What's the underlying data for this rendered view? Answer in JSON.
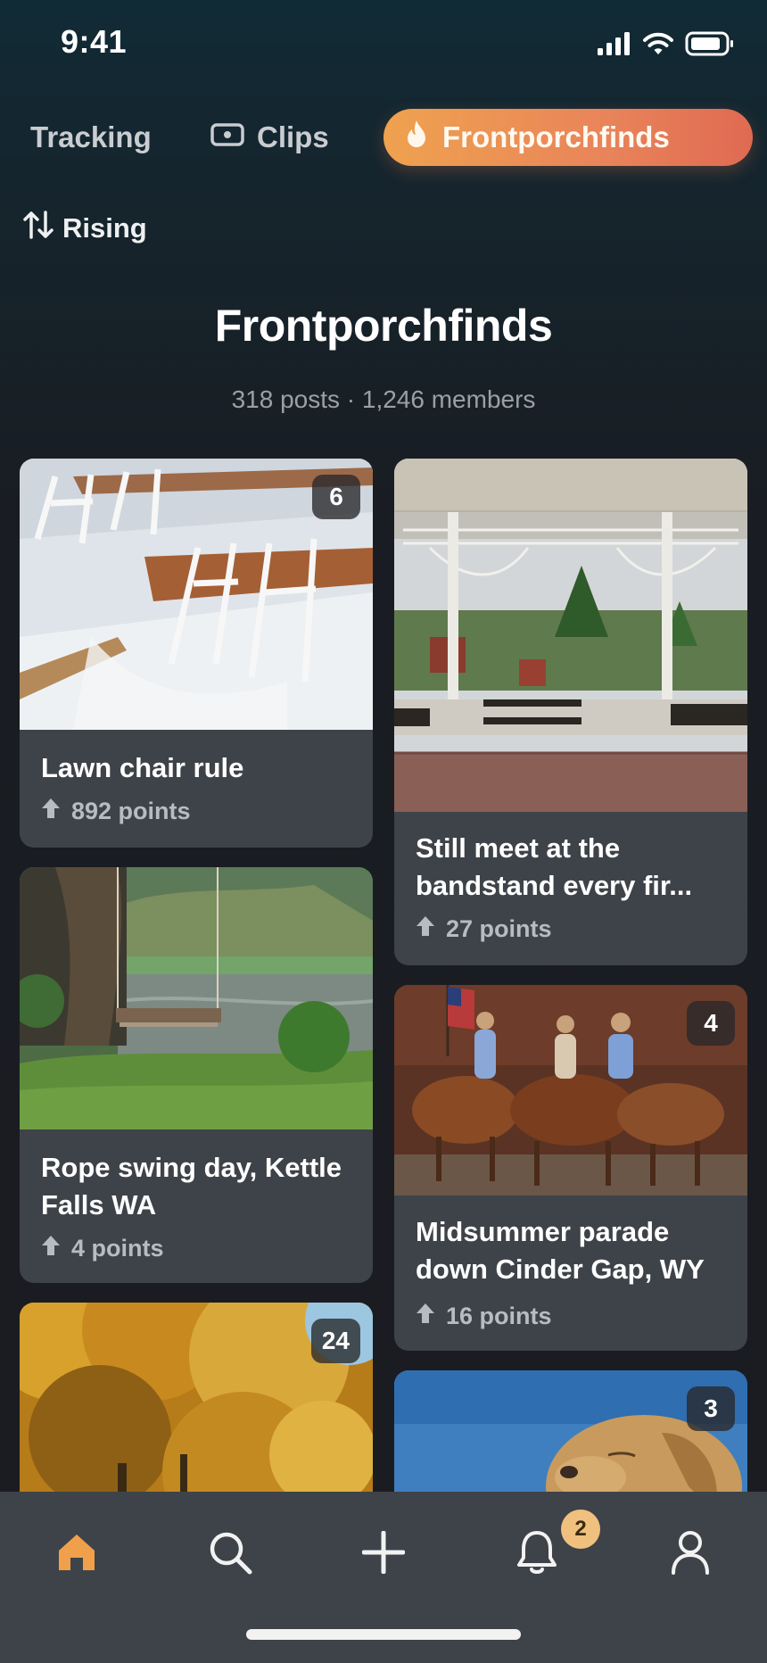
{
  "status_bar": {
    "time": "9:41"
  },
  "tabs": [
    {
      "label": "Tracking"
    },
    {
      "label": "Clips",
      "icon": "video-icon"
    },
    {
      "label": "Frontporchfinds",
      "icon": "flame-icon",
      "active": true
    }
  ],
  "sort": {
    "label": "Rising",
    "icon": "sort-arrows-icon"
  },
  "community": {
    "title": "Frontporchfinds",
    "meta": "318 posts · 1,246 members"
  },
  "posts": [
    {
      "title": "Lawn chair rule",
      "points": "892 points",
      "badge": "6",
      "image": "snowy-lawn-chairs"
    },
    {
      "title": "Still meet at the bandstand every fir...",
      "points": "27 points",
      "badge": "",
      "image": "gazebo-bandstand"
    },
    {
      "title": "Rope swing day, Kettle Falls WA",
      "points": "4 points",
      "badge": "",
      "image": "rope-swing-river"
    },
    {
      "title": "Midsummer parade down Cinder Gap, WY",
      "points": "16 points",
      "badge": "4",
      "image": "horse-parade"
    },
    {
      "title": "",
      "points": "",
      "badge": "24",
      "image": "autumn-trees"
    },
    {
      "title": "",
      "points": "",
      "badge": "3",
      "image": "dog-portrait"
    }
  ],
  "bottom_nav": {
    "items": [
      {
        "name": "home",
        "icon": "home-icon",
        "active": true
      },
      {
        "name": "search",
        "icon": "search-icon"
      },
      {
        "name": "create",
        "icon": "plus-icon"
      },
      {
        "name": "notifications",
        "icon": "bell-icon"
      },
      {
        "name": "profile",
        "icon": "person-icon"
      }
    ],
    "notification_count": "2"
  },
  "colors": {
    "accent": "#E9845A",
    "accent_start": "#EFA24F",
    "card": "#3E4349",
    "background": "#1A1C21",
    "home_active": "#F0A04B",
    "badge": "#F0C17E"
  }
}
